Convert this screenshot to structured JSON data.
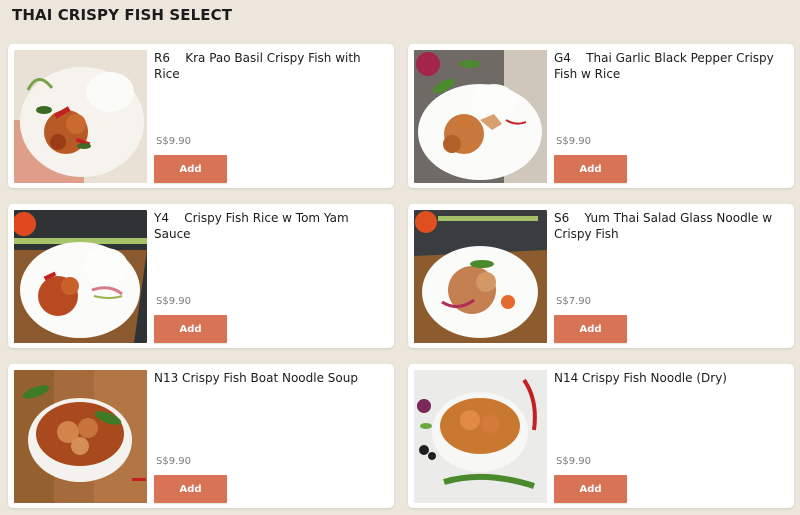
{
  "section": {
    "title": "THAI CRISPY FISH SELECT"
  },
  "products": [
    {
      "name": "R6    Kra Pao Basil Crispy Fish with Rice",
      "price": "S$9.90",
      "add_label": "Add"
    },
    {
      "name": "G4    Thai Garlic Black Pepper Crispy Fish w Rice",
      "price": "S$9.90",
      "add_label": "Add"
    },
    {
      "name": "Y4    Crispy Fish Rice w Tom Yam Sauce",
      "price": "S$9.90",
      "add_label": "Add"
    },
    {
      "name": "S6    Yum Thai Salad Glass Noodle w Crispy Fish",
      "price": "S$7.90",
      "add_label": "Add"
    },
    {
      "name": "N13 Crispy Fish Boat Noodle Soup",
      "price": "S$9.90",
      "add_label": "Add"
    },
    {
      "name": "N14 Crispy Fish Noodle (Dry)",
      "price": "S$9.90",
      "add_label": "Add"
    }
  ]
}
